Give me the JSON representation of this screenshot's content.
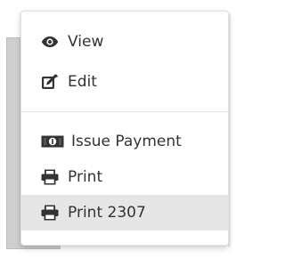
{
  "menu": {
    "items": [
      {
        "label": "View",
        "icon": "eye-icon"
      },
      {
        "label": "Edit",
        "icon": "edit-icon"
      },
      {
        "label": "Issue Payment",
        "icon": "money-bill-icon"
      },
      {
        "label": "Print",
        "icon": "printer-icon"
      },
      {
        "label": "Print 2307",
        "icon": "printer-icon",
        "highlighted": true
      }
    ]
  },
  "colors": {
    "text": "#333333",
    "hover_background": "#e6e6e6",
    "divider": "#e4e4e4"
  }
}
